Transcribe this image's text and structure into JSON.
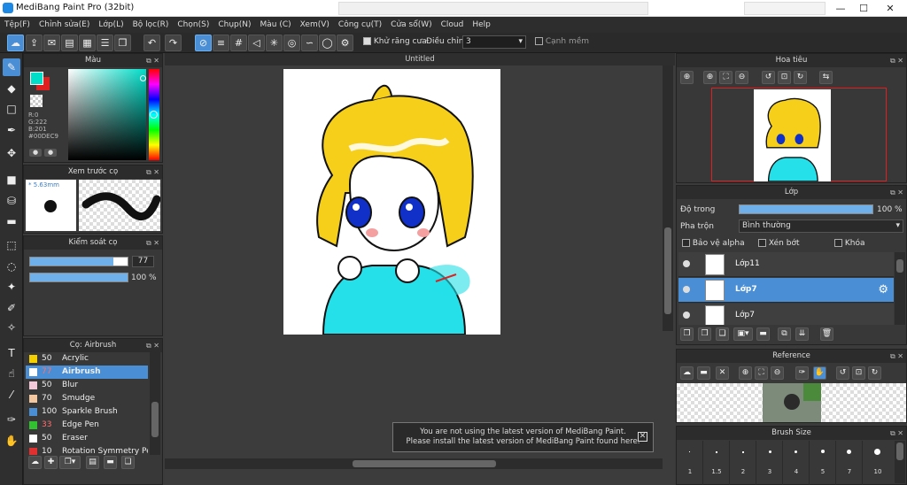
{
  "window": {
    "title": "MediBang Paint Pro (32bit)",
    "minimize": "—",
    "maximize": "☐",
    "close": "✕"
  },
  "menu": [
    "Tệp(F)",
    "Chỉnh sửa(E)",
    "Lớp(L)",
    "Bộ lọc(R)",
    "Chọn(S)",
    "Chụp(N)",
    "Màu (C)",
    "Xem(V)",
    "Công cụ(T)",
    "Cửa sổ(W)",
    "Cloud",
    "Help"
  ],
  "toolbar": {
    "antialias_label": "Khử răng cưa",
    "adjust_label": "Điều chỉnh",
    "adjust_value": "3",
    "smooth_edge_label": "Cạnh mềm"
  },
  "panels": {
    "color": {
      "title": "Màu",
      "r_label": "R:0",
      "g_label": "G:222",
      "b_label": "B:201",
      "hex": "#00DEC9",
      "primary_color": "#00dec9",
      "secondary_color": "#e02020"
    },
    "brush_preview": {
      "title": "Xem trước cọ",
      "size": "5.63mm"
    },
    "brush_control": {
      "title": "Kiểm soát cọ",
      "size_value": "77",
      "opacity_value": "100 %",
      "size_fraction": 0.85,
      "opacity_fraction": 1.0
    },
    "brush_list": {
      "title": "Cọ: Airbrush",
      "items": [
        {
          "size": "50",
          "name": "Acrylic",
          "color": "#f4d000"
        },
        {
          "size": "77",
          "name": "Airbrush",
          "color": "#ffffff",
          "selected": true
        },
        {
          "size": "50",
          "name": "Blur",
          "color": "#f3c8d8"
        },
        {
          "size": "70",
          "name": "Smudge",
          "color": "#f3c8a0"
        },
        {
          "size": "100",
          "name": "Sparkle Brush",
          "color": "#4a8fd6"
        },
        {
          "size": "33",
          "name": "Edge Pen",
          "color": "#30c030"
        },
        {
          "size": "50",
          "name": "Eraser",
          "color": "#ffffff"
        },
        {
          "size": "10",
          "name": "Rotation Symmetry Pen",
          "color": "#e03030"
        }
      ]
    },
    "navigator": {
      "title": "Hoa tiêu"
    },
    "layers": {
      "title": "Lớp",
      "opacity_label": "Độ trong",
      "opacity_value": "100 %",
      "blend_label": "Pha trộn",
      "blend_value": "Bình thường",
      "protect_alpha": "Bảo vệ alpha",
      "clipping": "Xén bớt",
      "lock": "Khóa",
      "items": [
        {
          "name": "Lớp11"
        },
        {
          "name": "Lớp7",
          "selected": true
        },
        {
          "name": "Lớp7"
        }
      ]
    },
    "reference": {
      "title": "Reference"
    },
    "brush_size": {
      "title": "Brush Size",
      "sizes": [
        "1",
        "1.5",
        "2",
        "3",
        "4",
        "5",
        "7",
        "10"
      ]
    }
  },
  "canvas": {
    "tab_title": "Untitled"
  },
  "notice": {
    "line1": "You are not using the latest version of MediBang Paint.",
    "line2": "Please install the latest version of MediBang Paint found here."
  }
}
